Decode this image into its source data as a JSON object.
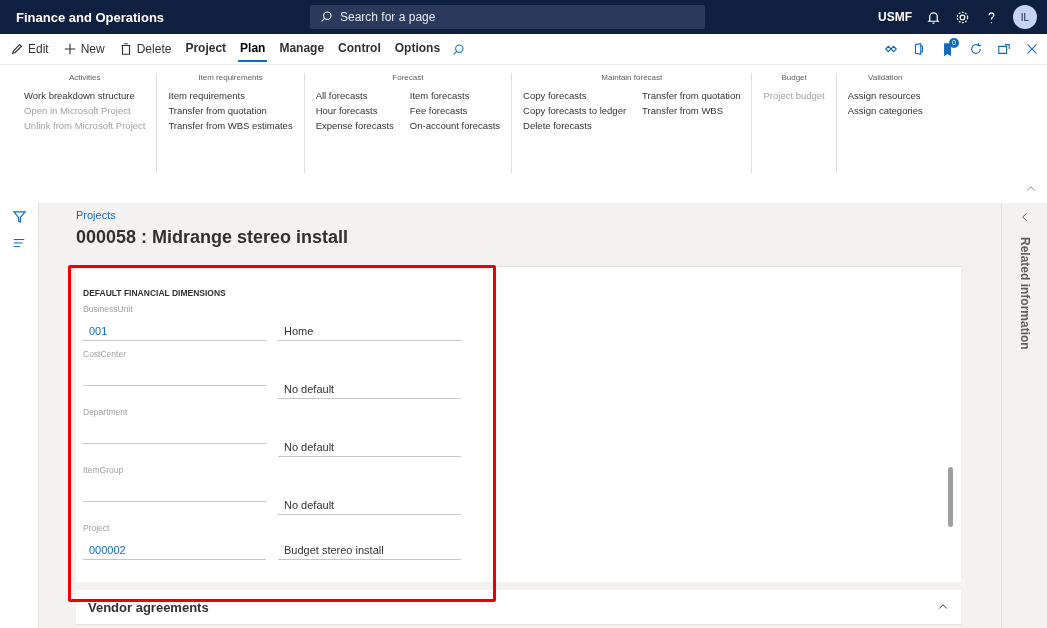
{
  "app_bar": {
    "title": "Finance and Operations",
    "search": {
      "placeholder": "Search for a page"
    },
    "company": "USMF",
    "avatar": "IL"
  },
  "action_bar": {
    "actions": [
      {
        "kind": "edit",
        "label": "Edit"
      },
      {
        "kind": "new",
        "label": "New"
      },
      {
        "kind": "delete",
        "label": "Delete"
      }
    ],
    "tabs": [
      {
        "label": "Project",
        "selected": false
      },
      {
        "label": "Plan",
        "selected": true
      },
      {
        "label": "Manage",
        "selected": false
      },
      {
        "label": "Control",
        "selected": false
      },
      {
        "label": "Options",
        "selected": false
      }
    ],
    "notification_badge": "0"
  },
  "ribbon": {
    "groups": [
      {
        "title": "Activities",
        "columns": [
          [
            {
              "label": "Work breakdown structure",
              "disabled": false
            },
            {
              "label": "Open in Microsoft Project",
              "disabled": true
            },
            {
              "label": "Unlink from Microsoft Project",
              "disabled": true
            }
          ]
        ]
      },
      {
        "title": "Item requirements",
        "columns": [
          [
            {
              "label": "Item requirements",
              "disabled": false
            },
            {
              "label": "Transfer from quotation",
              "disabled": false
            },
            {
              "label": "Transfer from WBS estimates",
              "disabled": false
            }
          ]
        ]
      },
      {
        "title": "Forecast",
        "columns": [
          [
            {
              "label": "All forecasts",
              "disabled": false
            },
            {
              "label": "Hour forecasts",
              "disabled": false
            },
            {
              "label": "Expense forecasts",
              "disabled": false
            }
          ],
          [
            {
              "label": "Item forecasts",
              "disabled": false
            },
            {
              "label": "Fee forecasts",
              "disabled": false
            },
            {
              "label": "On-account forecasts",
              "disabled": false
            }
          ]
        ]
      },
      {
        "title": "Maintain forecast",
        "columns": [
          [
            {
              "label": "Copy forecasts",
              "disabled": false
            },
            {
              "label": "Copy forecasts to ledger",
              "disabled": false
            },
            {
              "label": "Delete forecasts",
              "disabled": false
            }
          ],
          [
            {
              "label": "Transfer from quotation",
              "disabled": false
            },
            {
              "label": "Transfer from WBS",
              "disabled": false
            }
          ]
        ]
      },
      {
        "title": "Budget",
        "columns": [
          [
            {
              "label": "Project budget",
              "disabled": true
            }
          ]
        ]
      },
      {
        "title": "Validation",
        "columns": [
          [
            {
              "label": "Assign resources",
              "disabled": false
            },
            {
              "label": "Assign categories",
              "disabled": false
            }
          ]
        ]
      }
    ]
  },
  "page": {
    "breadcrumb": "Projects",
    "title": "000058 : Midrange stereo install"
  },
  "dimensions": {
    "heading": "DEFAULT FINANCIAL DIMENSIONS",
    "fields": [
      {
        "label": "BusinessUnit",
        "value": "001",
        "description": "Home"
      },
      {
        "label": "CostCenter",
        "description": "No default"
      },
      {
        "label": "Department",
        "description": "No default"
      },
      {
        "label": "ItemGroup",
        "description": "No default"
      },
      {
        "label": "Project",
        "value": "000002",
        "description": "Budget stereo install"
      }
    ]
  },
  "sections": [
    {
      "title": "Vendor agreements",
      "expanded": true
    }
  ],
  "side_pane": {
    "title": "Related information"
  }
}
